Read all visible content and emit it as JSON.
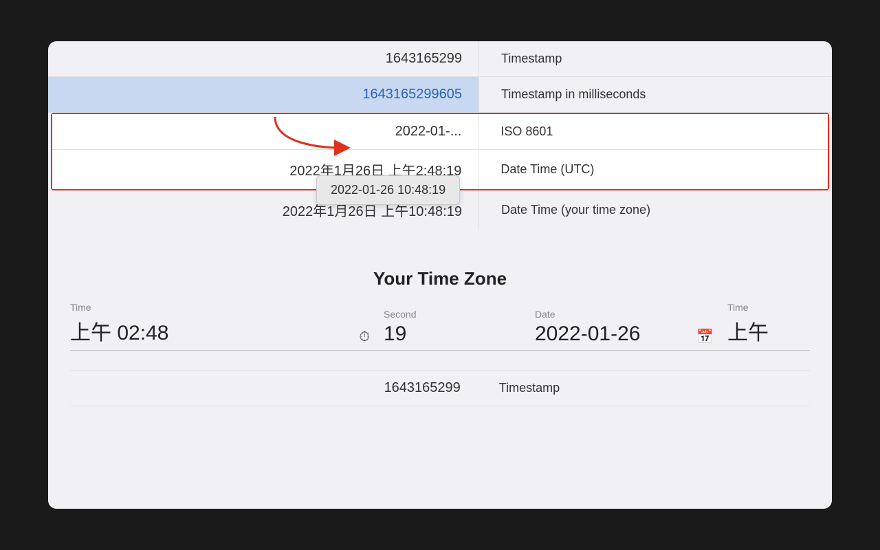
{
  "rows": [
    {
      "id": "timestamp",
      "left": "1643165299",
      "right": "Timestamp",
      "highlighted": false,
      "in_border": false
    },
    {
      "id": "timestamp-ms",
      "left": "1643165299605",
      "right": "Timestamp in milliseconds",
      "highlighted": true,
      "in_border": false
    },
    {
      "id": "iso8601",
      "left": "2022-01-26 10:48:19",
      "right": "ISO 8601",
      "highlighted": false,
      "in_border": true
    },
    {
      "id": "datetime-utc",
      "left": "2022年1月26日 上午2:48:19",
      "right": "Date Time (UTC)",
      "highlighted": false,
      "in_border": true
    }
  ],
  "row_local": {
    "left": "2022年1月26日 上午10:48:19",
    "right": "Date Time (your time zone)"
  },
  "tooltip": {
    "text": "2022-01-26 10:48:19"
  },
  "timezone_section": {
    "title": "Your Time Zone",
    "inputs": [
      {
        "label": "Time",
        "value": "上午 02:48",
        "icon": "clock",
        "id": "time-input"
      },
      {
        "label": "Second",
        "value": "19",
        "icon": null,
        "id": "second-input"
      },
      {
        "label": "Date",
        "value": "2022-01-26",
        "icon": "calendar",
        "id": "date-input"
      },
      {
        "label": "Time",
        "value": "上午",
        "icon": null,
        "id": "time-right-input"
      }
    ]
  },
  "bottom_row": {
    "left": "1643165299",
    "right": "Timestamp"
  },
  "left_edge": "s"
}
